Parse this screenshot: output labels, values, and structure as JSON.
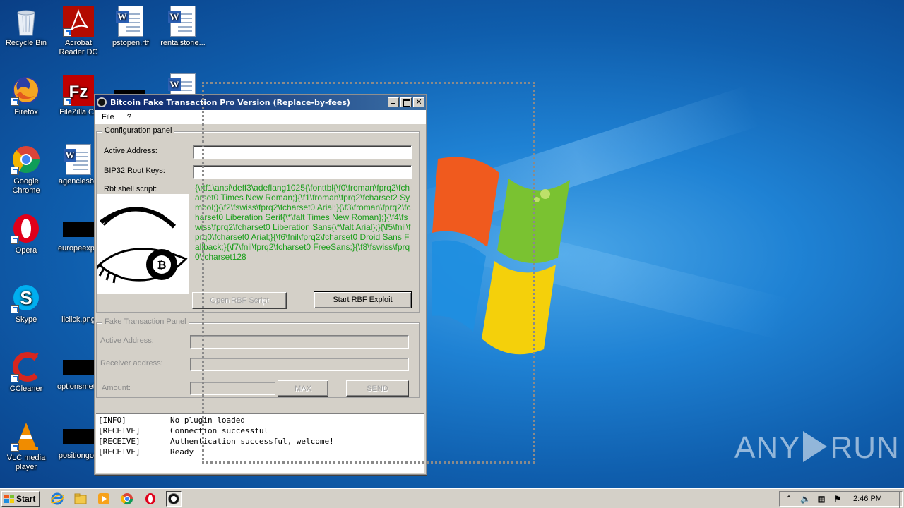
{
  "desktop": {
    "icons": [
      {
        "name": "recycle-bin",
        "label": "Recycle Bin"
      },
      {
        "name": "acrobat-reader",
        "label": "Acrobat Reader DC"
      },
      {
        "name": "pstopen-rtf",
        "label": "pstopen.rtf"
      },
      {
        "name": "rentalstories",
        "label": "rentalstorie..."
      },
      {
        "name": "firefox",
        "label": "Firefox"
      },
      {
        "name": "filezilla",
        "label": "FileZilla Cli"
      },
      {
        "name": "google-chrome",
        "label": "Google Chrome"
      },
      {
        "name": "agenciesba",
        "label": "agenciesba"
      },
      {
        "name": "opera",
        "label": "Opera"
      },
      {
        "name": "europeexpe",
        "label": "europeexpe"
      },
      {
        "name": "skype",
        "label": "Skype"
      },
      {
        "name": "llclick-png",
        "label": "llclick.png"
      },
      {
        "name": "ccleaner",
        "label": "CCleaner"
      },
      {
        "name": "optionsmeth",
        "label": "optionsmeth"
      },
      {
        "name": "vlc",
        "label": "VLC media player"
      },
      {
        "name": "positiongod",
        "label": "positiongod"
      }
    ],
    "watermark": {
      "left": "ANY",
      "right": "RUN"
    }
  },
  "window": {
    "title": "Bitcoin Fake Transaction Pro Version  (Replace-by-fees)",
    "controls": {
      "minimize": "_",
      "maximize": "□",
      "close": "✕"
    },
    "menu": [
      "File",
      "?"
    ]
  },
  "config_panel": {
    "legend": "Configuration panel",
    "active_address_label": "Active Address:",
    "active_address_value": "",
    "bip32_label": "BIP32 Root Keys:",
    "bip32_value": "",
    "rbf_label": "Rbf shell script:",
    "rbf_script": "{\\rtf1\\ansi\\deff3\\adeflang1025{\\fonttbl{\\f0\\froman\\fprq2\\fcharset0 Times New Roman;}{\\f1\\froman\\fprq2\\fcharset2 Symbol;}{\\f2\\fswiss\\fprq2\\fcharset0 Arial;}{\\f3\\froman\\fprq2\\fcharset0 Liberation Serif{\\*\\falt Times New Roman};}{\\f4\\fswiss\\fprq2\\fcharset0 Liberation Sans{\\*\\falt Arial};}{\\f5\\fnil\\fprq0\\fcharset0 Arial;}{\\f6\\fnil\\fprq2\\fcharset0 Droid Sans Fallback;}{\\f7\\fnil\\fprq2\\fcharset0 FreeSans;}{\\f8\\fswiss\\fprq0\\fcharset128",
    "open_button": "Open RBF Script",
    "start_button": "Start RBF Exploit"
  },
  "fake_panel": {
    "legend": "Fake Transaction Panel",
    "active_address_label": "Active Address:",
    "receiver_label": "Receiver address:",
    "amount_label": "Amount:",
    "max_button": "MAX",
    "send_button": "SEND"
  },
  "log": [
    {
      "tag": "[INFO]",
      "msg": "No plugin loaded"
    },
    {
      "tag": "[RECEIVE]",
      "msg": "Connection successful"
    },
    {
      "tag": "[RECEIVE]",
      "msg": "Authentication successful, welcome!"
    },
    {
      "tag": "[RECEIVE]",
      "msg": "Ready"
    }
  ],
  "taskbar": {
    "start": "Start",
    "clock": "2:46 PM"
  },
  "colors": {
    "titlebar_start": "#0a246a",
    "titlebar_end": "#3a6ea5",
    "script_green": "#1b9e1b",
    "desktop_blue": "#1f82d4"
  }
}
